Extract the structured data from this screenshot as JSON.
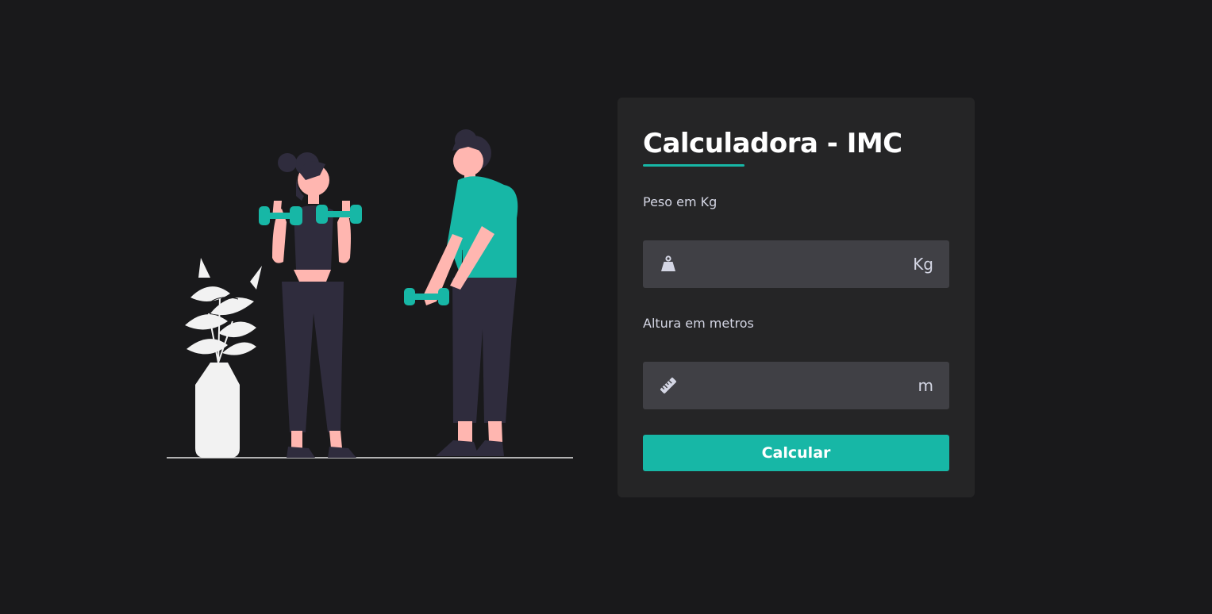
{
  "card": {
    "title": "Calculadora - IMC"
  },
  "weight": {
    "label": "Peso em Kg",
    "value": "",
    "unit": "Kg",
    "icon": "weight-icon"
  },
  "height": {
    "label": "Altura em metros",
    "value": "",
    "unit": "m",
    "icon": "ruler-icon"
  },
  "button": {
    "label": "Calcular"
  },
  "colors": {
    "background": "#19191b",
    "card": "#252526",
    "field": "#404045",
    "accent": "#17b7a6",
    "skin": "#ffb6b0",
    "clothing_dark": "#2f2c3d",
    "plant": "#f2f2f2"
  }
}
